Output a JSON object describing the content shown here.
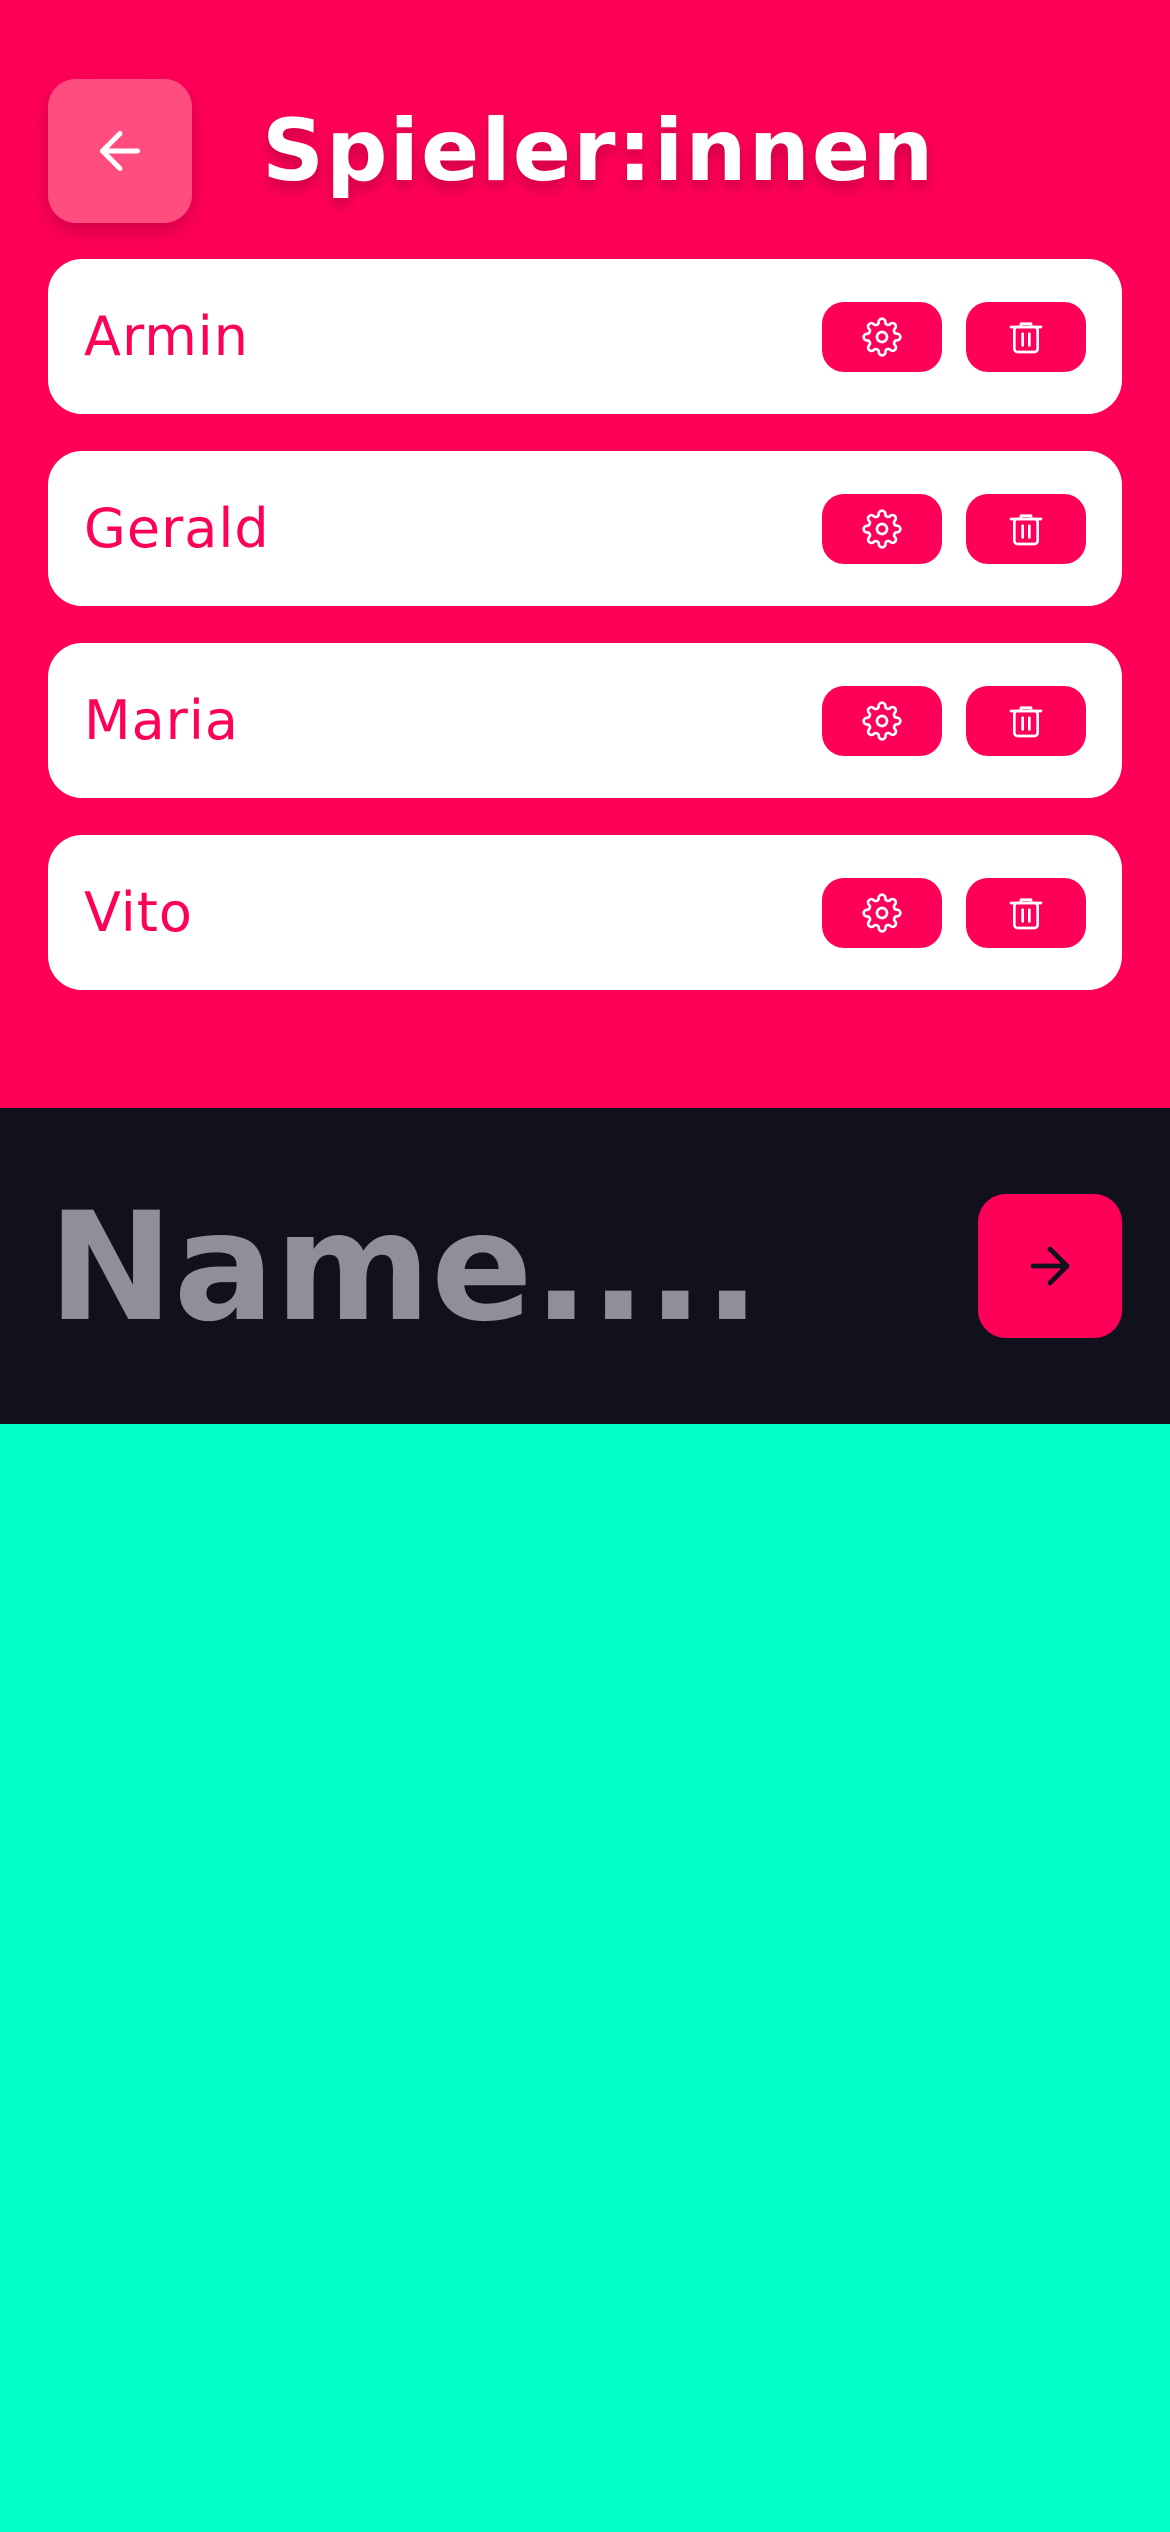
{
  "header": {
    "title": "Spieler:innen",
    "back_icon": "arrow-left-icon"
  },
  "players": [
    {
      "name": "Armin",
      "settings_icon": "gear-icon",
      "delete_icon": "trash-icon"
    },
    {
      "name": "Gerald",
      "settings_icon": "gear-icon",
      "delete_icon": "trash-icon"
    },
    {
      "name": "Maria",
      "settings_icon": "gear-icon",
      "delete_icon": "trash-icon"
    },
    {
      "name": "Vito",
      "settings_icon": "gear-icon",
      "delete_icon": "trash-icon"
    }
  ],
  "input": {
    "placeholder": "Name....",
    "value": "",
    "submit_icon": "arrow-right-icon"
  },
  "colors": {
    "primary": "#FF0058",
    "back_button": "#FF4D80",
    "input_background": "#10111D",
    "placeholder": "#8E8F99",
    "accent_background": "#00FFC6",
    "card": "#FFFFFF"
  }
}
